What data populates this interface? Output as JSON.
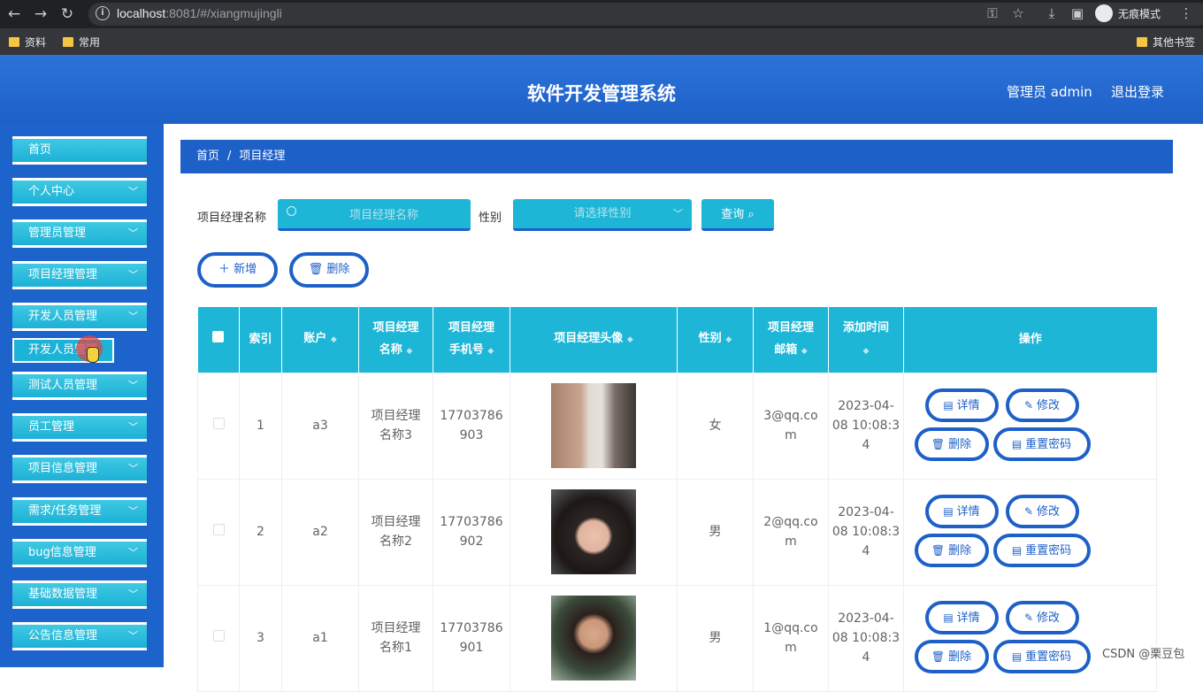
{
  "browser": {
    "url_host": "localhost",
    "url_rest": ":8081/#/xiangmujingli",
    "incognito_label": "无痕模式",
    "bookmarks": [
      "资料",
      "常用"
    ],
    "other_bookmarks": "其他书签",
    "icons": [
      "back-icon",
      "forward-icon",
      "reload-icon",
      "info-icon",
      "key-icon",
      "star-icon",
      "download-icon",
      "sidebar-icon",
      "incognito-icon",
      "kebab-icon"
    ]
  },
  "header": {
    "title": "软件开发管理系统",
    "admin": "管理员 admin",
    "logout": "退出登录"
  },
  "sidebar": {
    "items": [
      {
        "label": "首页",
        "chevron": ""
      },
      {
        "label": "个人中心",
        "chevron": "﹀"
      },
      {
        "label": "管理员管理",
        "chevron": "﹀"
      },
      {
        "label": "项目经理管理",
        "chevron": "﹀"
      },
      {
        "label": "开发人员管理",
        "chevron": "﹀"
      },
      {
        "label": "测试人员管理",
        "chevron": "﹀"
      },
      {
        "label": "员工管理",
        "chevron": "﹀"
      },
      {
        "label": "项目信息管理",
        "chevron": "﹀"
      },
      {
        "label": "需求/任务管理",
        "chevron": "﹀"
      },
      {
        "label": "bug信息管理",
        "chevron": "﹀"
      },
      {
        "label": "基础数据管理",
        "chevron": "﹀"
      },
      {
        "label": "公告信息管理",
        "chevron": "﹀"
      }
    ],
    "submenu": "开发人员管理"
  },
  "breadcrumb": {
    "home": "首页",
    "sep": "/",
    "current": "项目经理"
  },
  "search": {
    "name_label": "项目经理名称",
    "name_placeholder": "项目经理名称",
    "gender_label": "性别",
    "gender_placeholder": "请选择性别",
    "query": "查询"
  },
  "actions": {
    "add": "新增",
    "delete": "删除"
  },
  "table": {
    "headers": {
      "index": "索引",
      "account": "账户",
      "name1": "项目经理",
      "name2": "名称",
      "phone1": "项目经理",
      "phone2": "手机号",
      "avatar": "项目经理头像",
      "gender": "性别",
      "email1": "项目经理",
      "email2": "邮箱",
      "time1": "添加时间",
      "ops": "操作"
    },
    "rows": [
      {
        "index": "1",
        "account": "a3",
        "name1": "项目经理",
        "name2": "名称3",
        "phone1": "17703786",
        "phone2": "903",
        "gender": "女",
        "email1": "3@qq.co",
        "email2": "m",
        "time1": "2023-04-",
        "time2": "08 10:08:3",
        "time3": "4"
      },
      {
        "index": "2",
        "account": "a2",
        "name1": "项目经理",
        "name2": "名称2",
        "phone1": "17703786",
        "phone2": "902",
        "gender": "男",
        "email1": "2@qq.co",
        "email2": "m",
        "time1": "2023-04-",
        "time2": "08 10:08:3",
        "time3": "4"
      },
      {
        "index": "3",
        "account": "a1",
        "name1": "项目经理",
        "name2": "名称1",
        "phone1": "17703786",
        "phone2": "901",
        "gender": "男",
        "email1": "1@qq.co",
        "email2": "m",
        "time1": "2023-04-",
        "time2": "08 10:08:3",
        "time3": "4"
      }
    ],
    "row_ops": {
      "detail": "详情",
      "edit": "修改",
      "delete": "删除",
      "reset": "重置密码"
    }
  },
  "watermark": "CSDN @栗豆包"
}
